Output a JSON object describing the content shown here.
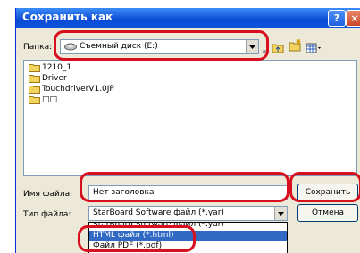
{
  "window": {
    "title": "Сохранить как",
    "help_glyph": "?",
    "close_glyph": "×"
  },
  "location": {
    "label": "Папка:",
    "value": "Съемный диск (E:)",
    "drive_icon": "removable-drive-icon"
  },
  "toolbar": {
    "icons": [
      "back-icon",
      "up-folder-icon",
      "new-folder-icon",
      "view-menu-icon"
    ]
  },
  "files": [
    "1210_1",
    "Driver",
    "TouchdriverV1.0JP",
    "□□"
  ],
  "filename": {
    "label": "Имя файла:",
    "value": "Нет заголовка"
  },
  "filetype": {
    "label": "Тип файла:",
    "value": "StarBoard Software файл (*.yar)",
    "options": [
      "StarBoard Software файл (*.yar)",
      "HTML файл (*.html)",
      "Файл PDF (*.pdf)"
    ],
    "selected_index": 1
  },
  "buttons": {
    "save": "Сохранить",
    "cancel": "Отмена"
  },
  "colors": {
    "highlight": "#d80f1e",
    "selection": "#316ac5",
    "titlebar": "#0a4ad6"
  }
}
